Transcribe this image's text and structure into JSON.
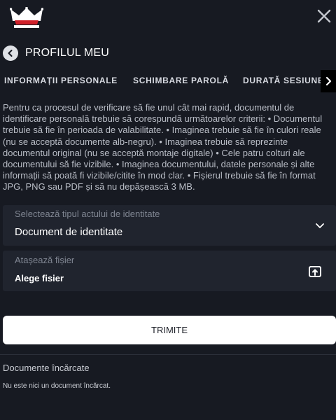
{
  "colors": {
    "background": "#171a22",
    "field_background": "#20242e",
    "button_background": "#ffffff",
    "logo_red": "#d0202a"
  },
  "icons": {
    "logo": "crown-logo",
    "close": "close-icon",
    "back": "chevron-left-icon",
    "tabs_next": "chevron-right-icon",
    "select": "chevron-down-icon",
    "upload": "upload-icon"
  },
  "header": {
    "title": "PROFILUL MEU"
  },
  "tabs": [
    {
      "label": "INFORMAȚII PERSONALE"
    },
    {
      "label": "SCHIMBARE PAROLĂ"
    },
    {
      "label": "DURATĂ SESIUNE"
    }
  ],
  "description": "Pentru ca procesul de verificare să fie unul cât mai rapid, documentul de identificare personală trebuie să corespundă următoarelor criterii: • Documentul trebuie să fie în perioada de valabilitate. • Imaginea trebuie să fie în culori reale (nu se acceptă documente alb-negru). • Imaginea trebuie să reprezinte documentul original (nu se acceptă montaje digitale) • Cele patru colturi ale documentului să fie vizibile. • Imaginea documentului, datele personale și alte informații să poată fi vizibile/citite în mod clar. • Fișierul trebuie să fie în format JPG, PNG sau PDF și să nu depășească 3 MB.",
  "form": {
    "id_type": {
      "label": "Selectează tipul actului de identitate",
      "value": "Document de identitate"
    },
    "attach": {
      "label": "Atașează fișier",
      "value": "Alege fisier"
    },
    "submit_label": "TRIMITE"
  },
  "documents": {
    "title": "Documente încărcate",
    "empty_text": "Nu este nici un document încărcat."
  }
}
